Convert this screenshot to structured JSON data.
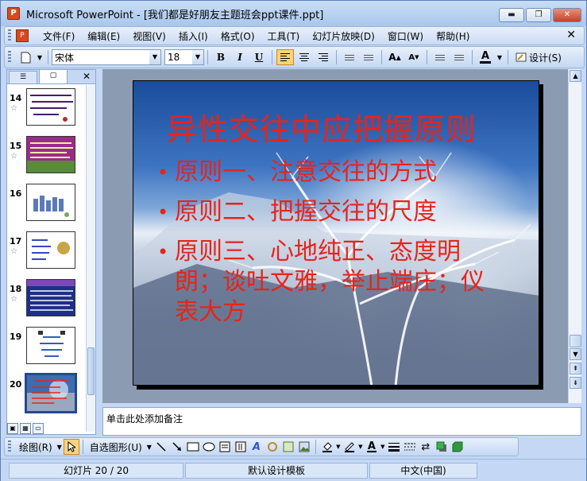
{
  "window": {
    "title": "Microsoft PowerPoint - [我们都是好朋友主题班会ppt课件.ppt]",
    "minimize_label": "▬",
    "maximize_label": "❐",
    "close_label": "✕"
  },
  "menu": {
    "items": [
      {
        "label": "文件(F)"
      },
      {
        "label": "编辑(E)"
      },
      {
        "label": "视图(V)"
      },
      {
        "label": "插入(I)"
      },
      {
        "label": "格式(O)"
      },
      {
        "label": "工具(T)"
      },
      {
        "label": "幻灯片放映(D)"
      },
      {
        "label": "窗口(W)"
      },
      {
        "label": "帮助(H)"
      }
    ],
    "close_label": "✕"
  },
  "toolbar": {
    "font_name": "宋体",
    "font_size": "18",
    "bold": "B",
    "italic": "I",
    "underline": "U",
    "design_label": "设计(S)"
  },
  "slide_panel": {
    "thumbnails": [
      {
        "number": "14",
        "has_animation": true
      },
      {
        "number": "15",
        "has_animation": true
      },
      {
        "number": "16",
        "has_animation": false
      },
      {
        "number": "17",
        "has_animation": true
      },
      {
        "number": "18",
        "has_animation": true
      },
      {
        "number": "19",
        "has_animation": false
      },
      {
        "number": "20",
        "has_animation": false,
        "selected": true
      }
    ]
  },
  "slide": {
    "title": "异性交往中应把握原则",
    "bullets": [
      "原则一、注意交往的方式",
      "原则二、把握交往的尺度",
      "原则三、心地纯正、态度明朗；谈吐文雅，举止端庄；仪表大方"
    ]
  },
  "notes": {
    "placeholder": "单击此处添加备注"
  },
  "drawing_toolbar": {
    "draw_label": "绘图(R)",
    "autoshapes_label": "自选图形(U)"
  },
  "status": {
    "slide_info": "幻灯片 20 / 20",
    "design_template": "默认设计模板",
    "language": "中文(中国)"
  }
}
